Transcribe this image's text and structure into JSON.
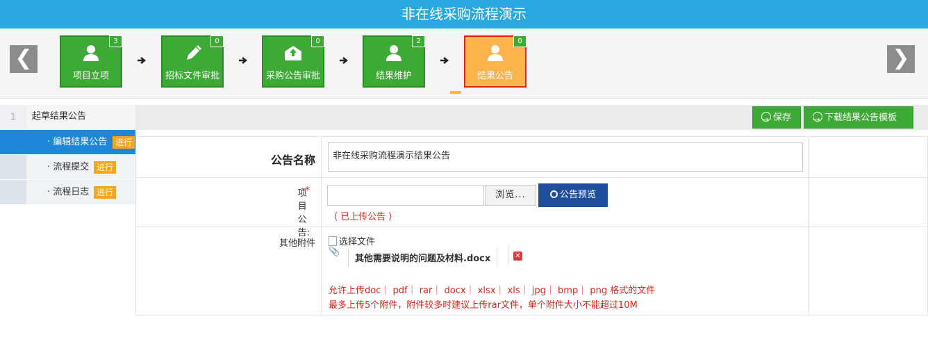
{
  "title": "非在线采购流程演示",
  "nav": {
    "prev": "❮",
    "next": "❯"
  },
  "steps": [
    {
      "label": "项目立项",
      "count": "3",
      "icon": "user-icon"
    },
    {
      "label": "招标文件审批",
      "count": "0",
      "icon": "pencil-icon"
    },
    {
      "label": "采购公告审批",
      "count": "0",
      "icon": "envelope-upload-icon"
    },
    {
      "label": "结果维护",
      "count": "2",
      "icon": "user-icon"
    },
    {
      "label": "结果公告",
      "count": "0",
      "icon": "user-icon",
      "active": true
    }
  ],
  "sidebar": {
    "stage_number": "1",
    "stage_title": "起草结果公告",
    "items": [
      {
        "label": "· 编辑结果公告",
        "tag": "进行"
      },
      {
        "label": "· 流程提交",
        "tag": "进行"
      },
      {
        "label": "· 流程日志",
        "tag": "进行"
      }
    ]
  },
  "toolbar": {
    "save_label": "保存",
    "download_label": "下载结果公告模板"
  },
  "form": {
    "name_label": "公告名称",
    "name_value": "非在线采购流程演示结果公告",
    "project_notice_label": "项目公告:",
    "required_mark": "*",
    "browse_label": "浏览...",
    "preview_label": "公告预览",
    "uploaded_note": "（ 已上传公告 ）",
    "other_attach_label": "其他附件",
    "choose_file_label": "选择文件",
    "attachment_name": "其他需要说明的问题及材料.docx",
    "hint_types": "允许上传doc｜ pdf｜ rar｜ docx｜ xlsx｜ xls｜ jpg｜ bmp｜ png 格式的文件",
    "hint_limit": "最多上传5个附件，附件较多时建议上传rar文件，单个附件大小不能超过10M"
  },
  "colors": {
    "header": "#2aa9e0",
    "step": "#3eaa36",
    "active_step": "#fbb34c",
    "tag": "#f8a41c",
    "selected": "#1e87d8",
    "preview": "#1f4e9c",
    "warn": "#e2231a"
  }
}
